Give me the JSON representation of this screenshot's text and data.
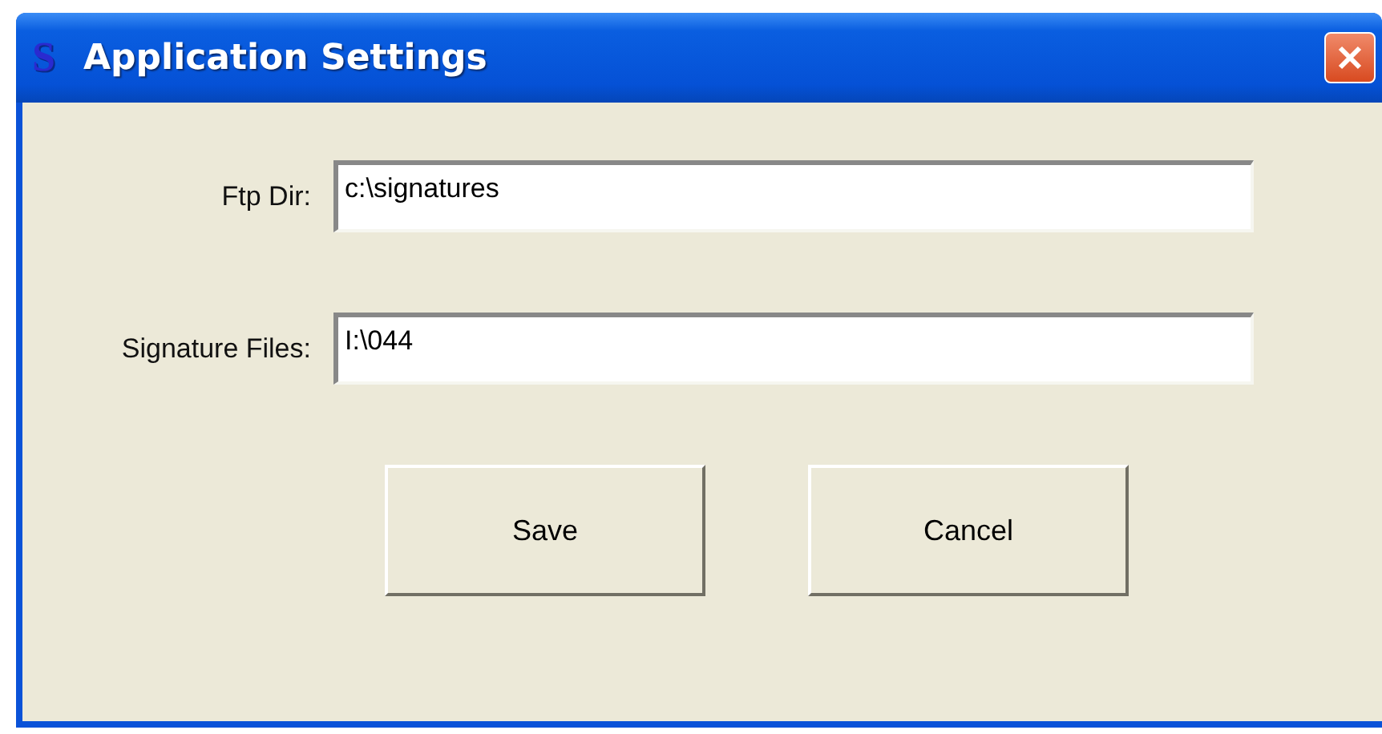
{
  "window": {
    "title": "Application Settings",
    "logo": "S"
  },
  "fields": [
    {
      "label": "Ftp Dir:",
      "value": "c:\\signatures"
    },
    {
      "label": "Signature Files:",
      "value": "I:\\044"
    }
  ],
  "buttons": [
    "Save",
    "Cancel"
  ]
}
